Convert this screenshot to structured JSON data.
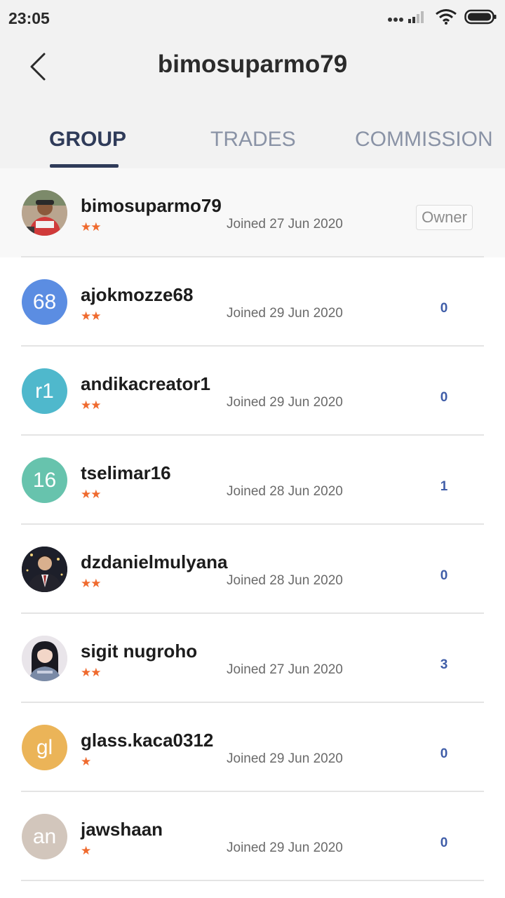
{
  "status_bar": {
    "time": "23:05",
    "icons": [
      "signal-icon",
      "wifi-icon",
      "battery-icon"
    ]
  },
  "header": {
    "title": "bimosuparmo79",
    "back_icon": "chevron-left-icon"
  },
  "tabs": [
    {
      "label": "GROUP",
      "active": true
    },
    {
      "label": "TRADES",
      "active": false
    },
    {
      "label": "COMMISSION",
      "active": false
    }
  ],
  "colors": {
    "accent": "#2f3b59",
    "star": "#ef6a2e",
    "count": "#3f5da8"
  },
  "members": [
    {
      "name": "bimosuparmo79",
      "avatar_type": "photo",
      "avatar_icon": "user-photo-icon",
      "stars": "★★",
      "joined": "Joined 27 Jun 2020",
      "owner_label": "Owner"
    },
    {
      "name": "ajokmozze68",
      "avatar_type": "initials",
      "initials": "68",
      "avatar_color": "#5b8de2",
      "stars": "★★",
      "joined": "Joined 29 Jun 2020",
      "count": "0"
    },
    {
      "name": "andikacreator1",
      "avatar_type": "initials",
      "initials": "r1",
      "avatar_color": "#4fb8cc",
      "stars": "★★",
      "joined": "Joined 29 Jun 2020",
      "count": "0"
    },
    {
      "name": "tselimar16",
      "avatar_type": "initials",
      "initials": "16",
      "avatar_color": "#67c3ad",
      "stars": "★★",
      "joined": "Joined 28 Jun 2020",
      "count": "1"
    },
    {
      "name": "dzdanielmulyana",
      "avatar_type": "photo",
      "avatar_icon": "user-photo-icon",
      "stars": "★★",
      "joined": "Joined 28 Jun 2020",
      "count": "0"
    },
    {
      "name": "sigit nugroho",
      "avatar_type": "photo",
      "avatar_icon": "user-photo-icon",
      "stars": "★★",
      "joined": "Joined 27 Jun 2020",
      "count": "3"
    },
    {
      "name": "glass.kaca0312",
      "avatar_type": "initials",
      "initials": "gl",
      "avatar_color": "#ebb458",
      "stars": "★",
      "joined": "Joined 29 Jun 2020",
      "count": "0"
    },
    {
      "name": "jawshaan",
      "avatar_type": "initials",
      "initials": "an",
      "avatar_color": "#d2c6bc",
      "stars": "★",
      "joined": "Joined 29 Jun 2020",
      "count": "0"
    }
  ]
}
